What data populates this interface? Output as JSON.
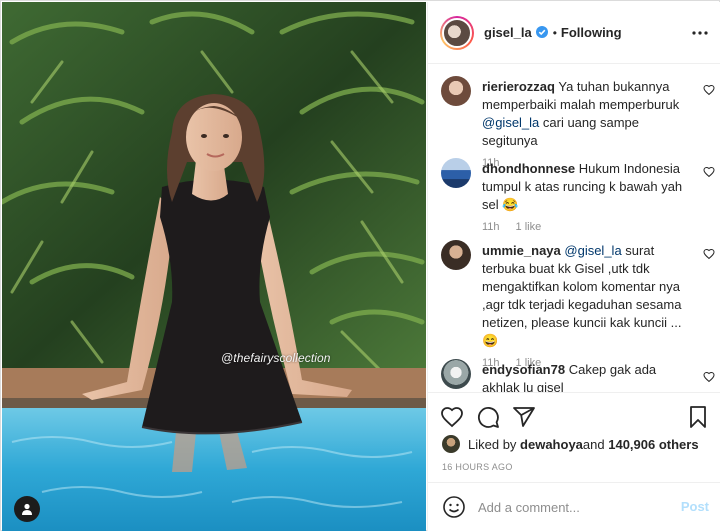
{
  "photo": {
    "watermark": "@thefairyscollection",
    "tag_icon": "person-icon"
  },
  "header": {
    "username": "gisel_la",
    "verified_icon": "verified-badge-icon",
    "separator": "•",
    "follow_status": "Following",
    "more_icon": "more-options-icon"
  },
  "comments": [
    {
      "username": "rierierozzaq",
      "text_before": " Ya tuhan bukannya memperbaiki malah memperburuk ",
      "mention": "@gisel_la",
      "text_after": " cari uang sampe segitunya",
      "time": "11h",
      "likes": ""
    },
    {
      "username": "dhondhonnese",
      "text_before": " Hukum Indonesia tumpul k atas runcing k bawah yah sel ",
      "mention": "",
      "text_after": "😂",
      "time": "11h",
      "likes": "1 like"
    },
    {
      "username": "ummie_naya",
      "text_before": " ",
      "mention": "@gisel_la",
      "text_after": " surat terbuka buat kk Gisel ,utk tdk mengaktifkan kolom komentar nya ,agr tdk terjadi kegaduhan sesama netizen, please kuncii kak kuncii ...😄",
      "time": "11h",
      "likes": "1 like"
    },
    {
      "username": "endysofian78",
      "text_before": " Cakep gak ada akhlak lu gisel",
      "mention": "",
      "text_after": "",
      "time": "",
      "likes": ""
    }
  ],
  "actions": {
    "like_icon": "heart-icon",
    "comment_icon": "comment-icon",
    "share_icon": "share-icon",
    "save_icon": "bookmark-icon"
  },
  "likes": {
    "prefix": "Liked by ",
    "user": "dewahoya",
    "middle": " and ",
    "count": "140,906 others"
  },
  "date": "16 HOURS AGO",
  "add_comment": {
    "placeholder": "Add a comment...",
    "post_label": "Post"
  },
  "colors": {
    "mention": "#00376b",
    "muted": "#8e8e8e",
    "post_disabled": "#b2dffc",
    "border": "#efefef"
  }
}
